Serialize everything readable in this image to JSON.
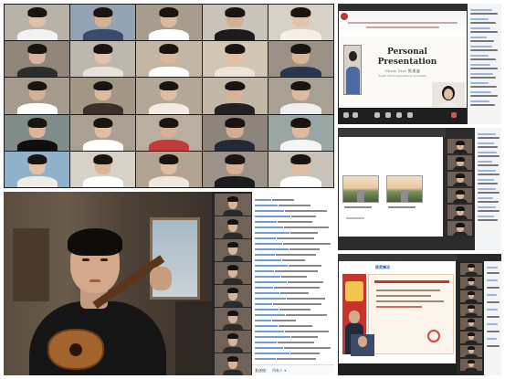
{
  "gallery": {
    "tiles": [
      {
        "name": "",
        "bg": "#b8b2a8",
        "skin": "#e0bfa6",
        "shirt": "#f2f2f2"
      },
      {
        "name": "",
        "bg": "#93a3b3",
        "skin": "#d8b195",
        "shirt": "#3a4a6a"
      },
      {
        "name": "",
        "bg": "#a89c8e",
        "skin": "#dcb89e",
        "shirt": "#ffffff"
      },
      {
        "name": "",
        "bg": "#c9c4bb",
        "skin": "#d6ae93",
        "shirt": "#1b1b1b"
      },
      {
        "name": "",
        "bg": "#d8d1c6",
        "skin": "#e3c3ab",
        "shirt": "#f5efe6"
      },
      {
        "name": "",
        "bg": "#8f8579",
        "skin": "#d9b39a",
        "shirt": "#2d2d2d"
      },
      {
        "name": "",
        "bg": "#bdb7ad",
        "skin": "#e1c2ab",
        "shirt": "#e8e2da"
      },
      {
        "name": "",
        "bg": "#c4b6a3",
        "skin": "#dbb79c",
        "shirt": "#ffffff"
      },
      {
        "name": "",
        "bg": "#d2c7b5",
        "skin": "#e2bfa4",
        "shirt": "#f0e4d8"
      },
      {
        "name": "",
        "bg": "#9b9186",
        "skin": "#d8b398",
        "shirt": "#2a3550"
      },
      {
        "name": "",
        "bg": "#a59a8c",
        "skin": "#d6af94",
        "shirt": "#ffffff"
      },
      {
        "name": "",
        "bg": "#a29684",
        "skin": "#ddbaa0",
        "shirt": "#3c2f2a"
      },
      {
        "name": "",
        "bg": "#b3a898",
        "skin": "#dfbda3",
        "shirt": "#f1ebe3"
      },
      {
        "name": "",
        "bg": "#c2b8a8",
        "skin": "#d8b297",
        "shirt": "#222222"
      },
      {
        "name": "",
        "bg": "#a9a094",
        "skin": "#dcb99f",
        "shirt": "#efefef"
      },
      {
        "name": "",
        "bg": "#7f8c8a",
        "skin": "#dab59b",
        "shirt": "#0f0f0f"
      },
      {
        "name": "",
        "bg": "#a99f93",
        "skin": "#e0bea5",
        "shirt": "#ffffff"
      },
      {
        "name": "",
        "bg": "#b9aea0",
        "skin": "#d7b095",
        "shirt": "#c23a3a"
      },
      {
        "name": "",
        "bg": "#8d857c",
        "skin": "#d5ad92",
        "shirt": "#232a36"
      },
      {
        "name": "",
        "bg": "#9aa6a3",
        "skin": "#ddbba1",
        "shirt": "#f5f5f5"
      },
      {
        "name": "",
        "bg": "#8fb1c9",
        "skin": "#e1c0a6",
        "shirt": "#f0ebe5"
      },
      {
        "name": "",
        "bg": "#d7d1c7",
        "skin": "#dab69b",
        "shirt": "#ffffff"
      },
      {
        "name": "",
        "bg": "#b3a492",
        "skin": "#dfbca2",
        "shirt": "#efe8df"
      },
      {
        "name": "",
        "bg": "#9b938a",
        "skin": "#d6af94",
        "shirt": "#1c1c1c"
      },
      {
        "name": "",
        "bg": "#c9c2b8",
        "skin": "#e0bea4",
        "shirt": "#ffffff"
      }
    ]
  },
  "presentation": {
    "slide_title": "Personal\nPresentation",
    "subtitle": "Chen Yizi 陈逸姿",
    "university": "South China Agricultural University"
  },
  "chat": {
    "label": "发送给：",
    "target": "所有人 ▾"
  },
  "certificate": {
    "title": "获奖情况"
  }
}
